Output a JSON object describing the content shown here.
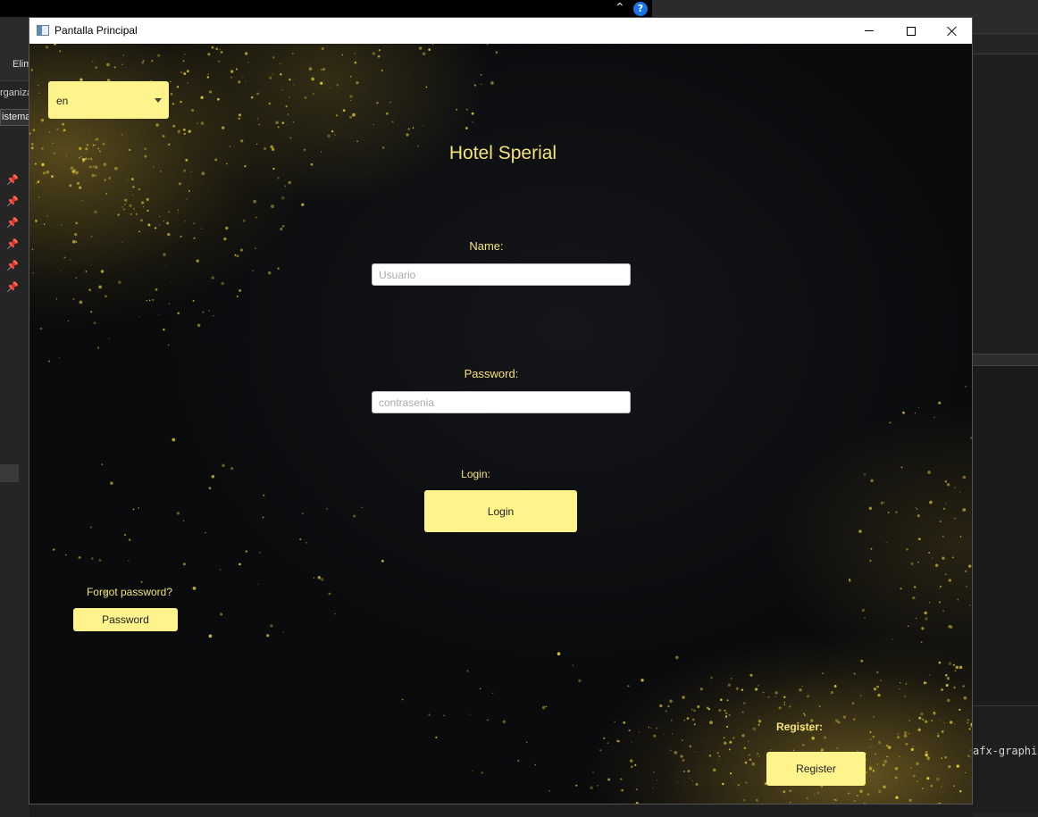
{
  "background_ide": {
    "toolbar_text": "Elim",
    "organize_text": "rganiza",
    "system_tab": "istema",
    "code_snippet": "afx-graphic"
  },
  "window": {
    "title": "Pantalla Principal",
    "icon": "java-window-icon"
  },
  "language": {
    "selected": "en"
  },
  "heading": "Hotel Sperial",
  "form": {
    "name_label": "Name:",
    "name_placeholder": "Usuario",
    "name_value": "",
    "password_label": "Password:",
    "password_placeholder": "contrasenia",
    "password_value": "",
    "login_label": "Login:",
    "login_button": "Login"
  },
  "forgot": {
    "label": "Forgot password?",
    "button": "Password"
  },
  "register": {
    "label": "Register:",
    "button": "Register"
  },
  "colors": {
    "accent": "#fff48c",
    "label_text": "#f6e27a",
    "background": "#0b0c0e"
  }
}
